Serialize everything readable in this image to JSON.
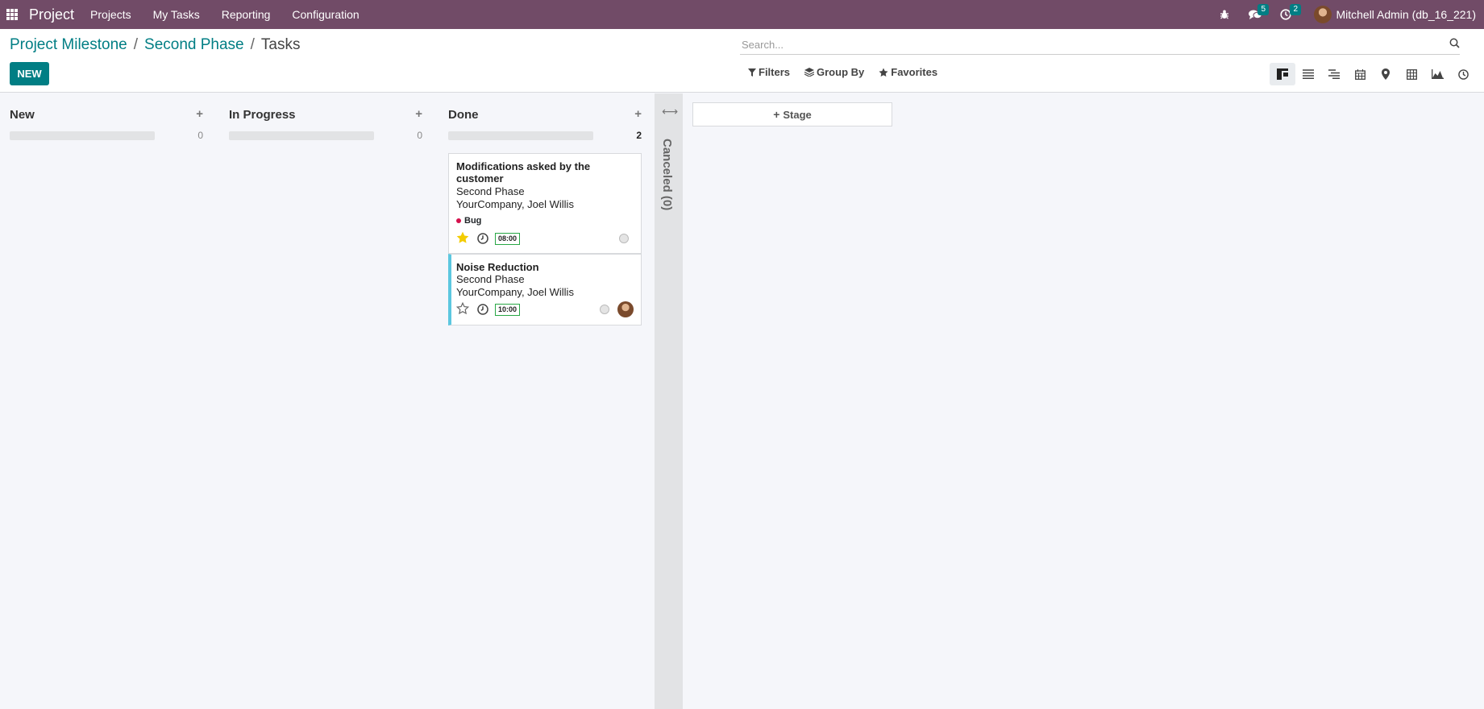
{
  "navbar": {
    "brand": "Project",
    "menu": [
      "Projects",
      "My Tasks",
      "Reporting",
      "Configuration"
    ],
    "messages_count": "5",
    "activities_count": "2",
    "user": "Mitchell Admin (db_16_221)"
  },
  "control": {
    "breadcrumb": [
      "Project Milestone",
      "Second Phase",
      "Tasks"
    ],
    "new_label": "NEW",
    "search_placeholder": "Search...",
    "filters_label": "Filters",
    "groupby_label": "Group By",
    "favorites_label": "Favorites"
  },
  "columns": [
    {
      "title": "New",
      "count": "0"
    },
    {
      "title": "In Progress",
      "count": "0"
    },
    {
      "title": "Done",
      "count": "2"
    }
  ],
  "cards": [
    {
      "title": "Modifications asked by the customer",
      "project": "Second Phase",
      "assignees": "YourCompany, Joel Willis",
      "tag": "Bug",
      "hours": "08:00",
      "starred": true
    },
    {
      "title": "Noise Reduction",
      "project": "Second Phase",
      "assignees": "YourCompany, Joel Willis",
      "hours": "10:00",
      "starred": false
    }
  ],
  "folded_column": {
    "title": "Canceled (0)"
  },
  "stage_button": "Stage",
  "colors": {
    "navbar": "#714b67",
    "primary": "#017e84",
    "tag_bug": "#d5104c",
    "star": "#f3cc00"
  }
}
